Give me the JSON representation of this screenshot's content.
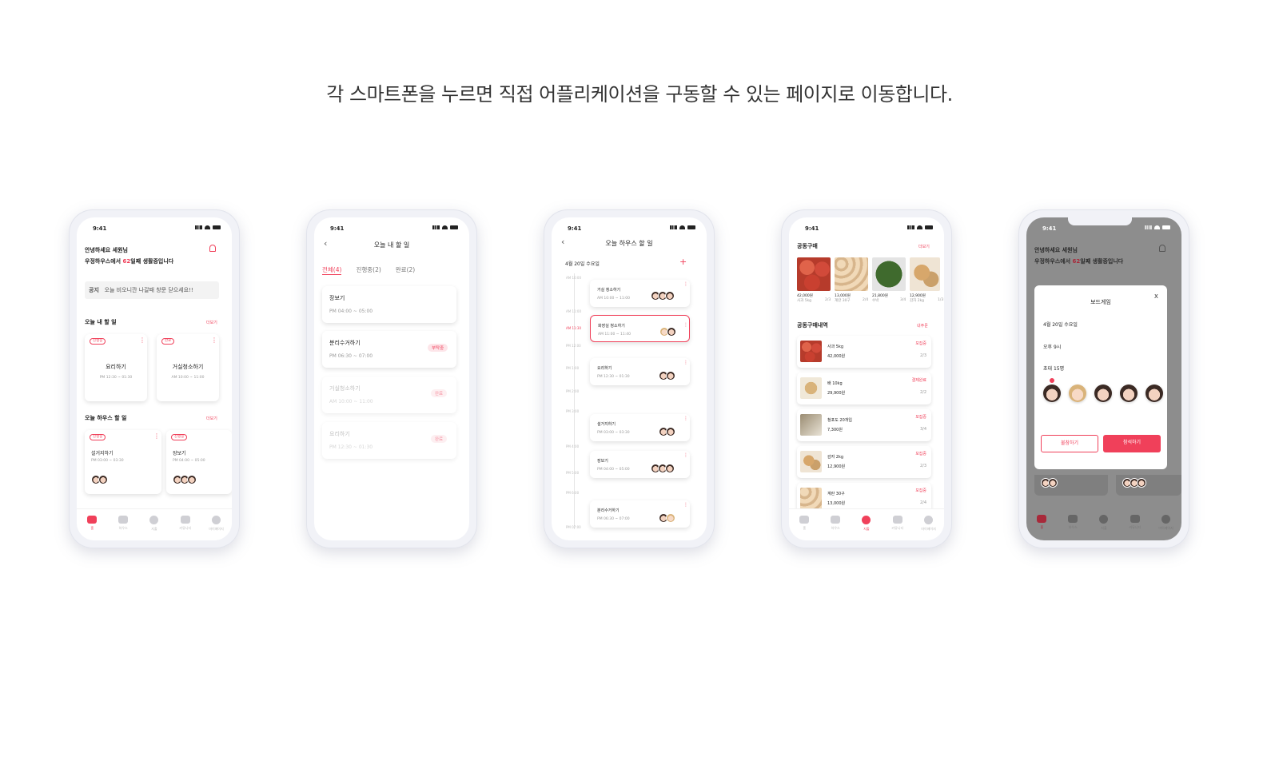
{
  "headline": "각 스마트폰을 누르면 직접 어플리케이션을 구동할 수 있는 페이지로 이동합니다.",
  "status_time": "9:41",
  "tabbar": {
    "home": "홈",
    "house": "하우스",
    "wallet": "지출",
    "community": "커뮤니티",
    "mypage": "마이페이지"
  },
  "phone1": {
    "greeting": "안녕하세요 세원님",
    "days_line_pre": "우정하우스에서 ",
    "days_count": "62",
    "days_line_post": "일째 생활중입니다",
    "notice_label": "공지",
    "notice_text": "오늘 비오니깐 나갈때 창문 닫으세요!!",
    "my_tasks_title": "오늘 내 할 일",
    "more": "더보기",
    "my_tasks": [
      {
        "tag": "진행중",
        "title": "요리하기",
        "time": "PM 12:30 ~ 01:30"
      },
      {
        "tag": "완료",
        "title": "거실청소하기",
        "time": "AM 10:00 ~ 11:00"
      }
    ],
    "house_tasks_title": "오늘 하우스 할 일",
    "house_tasks": [
      {
        "tag": "진행중",
        "title": "설거지하기",
        "time": "PM 03:00 ~ 03:30"
      },
      {
        "tag": "진행중",
        "title": "장보기",
        "time": "PM 04:00 ~ 05:00"
      }
    ]
  },
  "phone2": {
    "title": "오늘 내 할 일",
    "tabs": [
      "전체(4)",
      "진행중(2)",
      "완료(2)"
    ],
    "items": [
      {
        "title": "장보기",
        "time": "PM 04:00 ~ 05:00",
        "badge": ""
      },
      {
        "title": "분리수거하기",
        "time": "PM 06:30 ~ 07:00",
        "badge": "부탁중"
      },
      {
        "title": "거실청소하기",
        "time": "AM 10:00 ~ 11:00",
        "badge": "완료"
      },
      {
        "title": "요리하기",
        "time": "PM 12:30 ~ 01:30",
        "badge": "완료"
      }
    ]
  },
  "phone3": {
    "title": "오늘 하우스 할 일",
    "date": "4월 20일 수요일",
    "add": "+",
    "times": [
      "AM 10:00",
      "AM 11:00",
      "AM 11:30",
      "PM 12:00",
      "PM 1:00",
      "PM 2:00",
      "PM 3:00",
      "PM 4:00",
      "PM 5:00",
      "PM 6:00",
      "PM 07:00"
    ],
    "items": [
      {
        "title": "거실 청소하기",
        "time": "AM 10:00 ~ 11:00"
      },
      {
        "title": "화장실 청소하기",
        "time": "AM 11:00 ~ 11:40"
      },
      {
        "title": "요리하기",
        "time": "PM 12:30 ~ 01:30"
      },
      {
        "title": "설거지하기",
        "time": "PM 03:00 ~ 03:30"
      },
      {
        "title": "장보기",
        "time": "PM 04:00 ~ 05:00"
      },
      {
        "title": "분리수거하기",
        "time": "PM 06:30 ~ 07:00"
      }
    ]
  },
  "phone4": {
    "group_buy_title": "공동구매",
    "more": "더보기",
    "products": [
      {
        "price": "42,000원",
        "name": "사과 5kg",
        "count": "2/3"
      },
      {
        "price": "13,000원",
        "name": "계란 30구",
        "count": "2/4"
      },
      {
        "price": "21,800원",
        "name": "수박",
        "count": "3/4"
      },
      {
        "price": "12,900원",
        "name": "감자 2kg",
        "count": "1/3"
      }
    ],
    "history_title": "공동구매내역",
    "history_more": "내주문",
    "history": [
      {
        "name": "사과 5kg",
        "price": "42,000원",
        "status": "모집중",
        "count": "2/3"
      },
      {
        "name": "배 10kg",
        "price": "29,900원",
        "status": "결제완료",
        "count": "2/2"
      },
      {
        "name": "청포도 20개입",
        "price": "7,300원",
        "status": "모집중",
        "count": "3/4"
      },
      {
        "name": "감자 2kg",
        "price": "12,900원",
        "status": "모집중",
        "count": "2/3"
      },
      {
        "name": "계란 30구",
        "price": "13,000원",
        "status": "모집중",
        "count": "2/4"
      }
    ]
  },
  "phone5": {
    "greeting": "안녕하세요 세원님",
    "days_line_pre": "우정하우스에서 ",
    "days_count": "62",
    "days_line_post": "일째 생활중입니다",
    "modal_title": "보드게임",
    "modal_close": "X",
    "modal_date": "4월 20일 수요일",
    "modal_time": "오후 9시",
    "modal_invite": "초대 15명",
    "decline": "불참하기",
    "accept": "참석하기"
  },
  "colors": {
    "accent": "#f0405a",
    "accent_light": "#fde5e9"
  }
}
